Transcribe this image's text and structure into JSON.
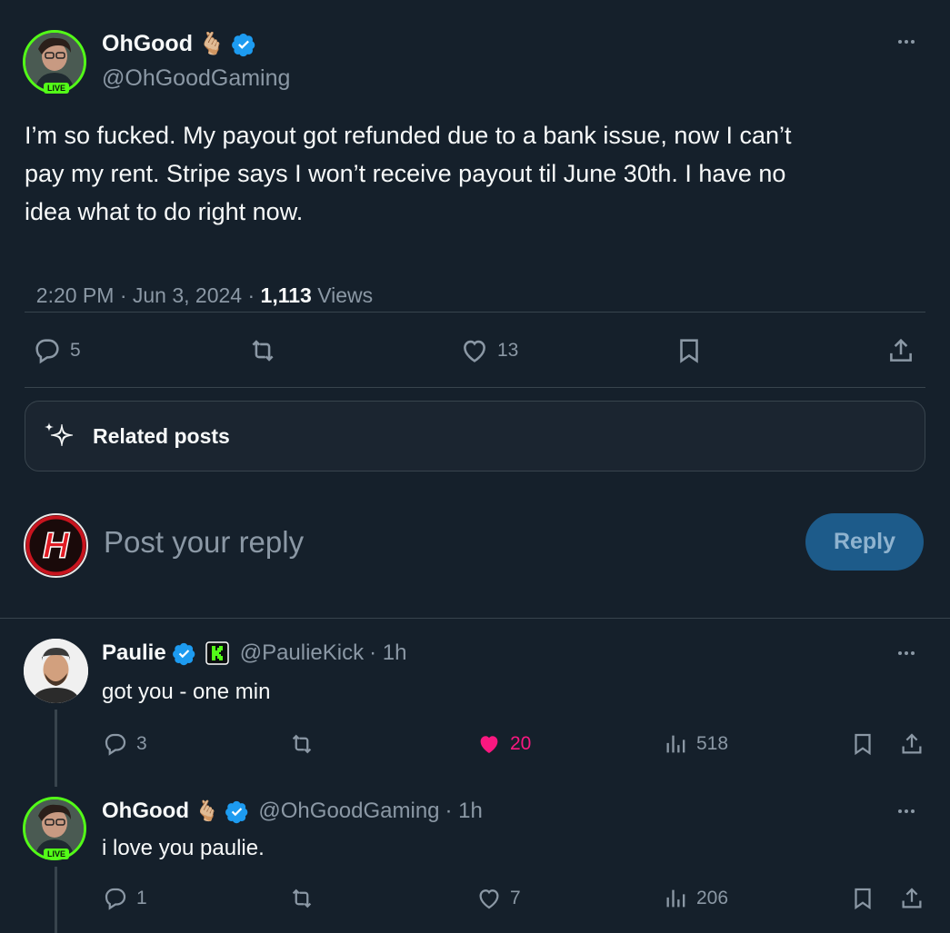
{
  "main_post": {
    "display_name": "OhGood",
    "emoji": "🫰🏼",
    "handle": "@OhGoodGaming",
    "live_label": "LIVE",
    "text_line1": "I’m so fucked. My payout got refunded due to a bank issue, now I can’t",
    "text_line2": "pay my rent. Stripe says I won’t receive payout til June 30th. I have no",
    "text_line3": "idea what to do right now.",
    "time": "2:20 PM · Jun 3, 2024 · ",
    "views_count": "1,113",
    "views_label": " Views",
    "replies": "5",
    "likes": "13"
  },
  "related_posts_label": "Related posts",
  "composer": {
    "placeholder": "Post your reply",
    "reply_label": "Reply"
  },
  "replies": [
    {
      "display_name": "Paulie",
      "handle": "@PaulieKick",
      "time": "· 1h",
      "text": "got you - one min",
      "replies": "3",
      "likes": "20",
      "views": "518"
    },
    {
      "display_name": "OhGood",
      "emoji": "🫰🏼",
      "handle": "@OhGoodGaming",
      "time": "· 1h",
      "live_label": "LIVE",
      "text": "i love you paulie.",
      "replies": "1",
      "likes": "7",
      "views": "206"
    }
  ],
  "colors": {
    "background": "#15202b",
    "accent": "#1d9bf0",
    "like_pink": "#f91880",
    "kick_green": "#53fc18"
  }
}
